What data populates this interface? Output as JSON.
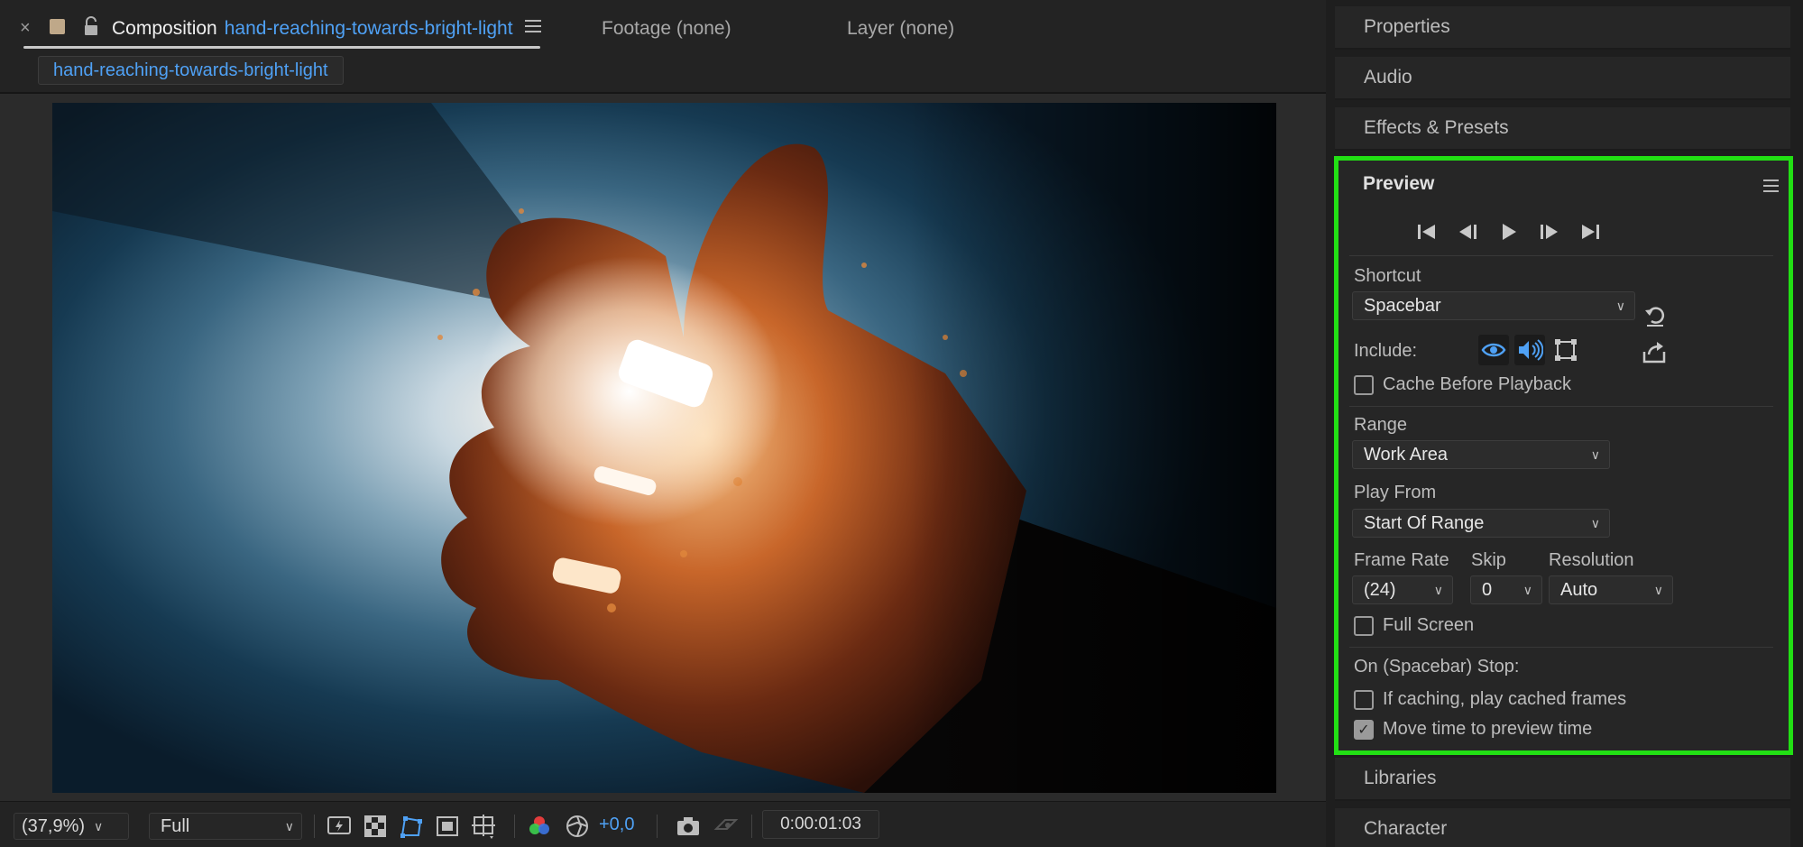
{
  "composition": {
    "tab_prefix": "Composition",
    "tab_name": "hand-reaching-towards-bright-light",
    "breadcrumb": "hand-reaching-towards-bright-light",
    "footage_tab": "Footage (none)",
    "layer_tab": "Layer (none)"
  },
  "viewer_bar": {
    "zoom": "(37,9%)",
    "resolution": "Full",
    "exposure": "+0,0",
    "timecode": "0:00:01:03"
  },
  "panels": {
    "properties": "Properties",
    "audio": "Audio",
    "effects": "Effects & Presets",
    "libraries": "Libraries",
    "character": "Character"
  },
  "preview": {
    "title": "Preview",
    "shortcut_label": "Shortcut",
    "shortcut_value": "Spacebar",
    "include_label": "Include:",
    "cache_before_playback": "Cache Before Playback",
    "range_label": "Range",
    "range_value": "Work Area",
    "play_from_label": "Play From",
    "play_from_value": "Start Of Range",
    "frame_rate_label": "Frame Rate",
    "frame_rate_value": "(24)",
    "skip_label": "Skip",
    "skip_value": "0",
    "resolution_label": "Resolution",
    "resolution_value": "Auto",
    "full_screen": "Full Screen",
    "on_stop_label": "On (Spacebar) Stop:",
    "if_caching": "If caching, play cached frames",
    "move_time": "Move time to preview time",
    "checkboxes": {
      "cache_before_playback": false,
      "full_screen": false,
      "if_caching": false,
      "move_time": true
    }
  },
  "colors": {
    "accent_blue": "#4fa1f5",
    "highlight_green": "#22e014",
    "panel_bg": "#262626"
  }
}
